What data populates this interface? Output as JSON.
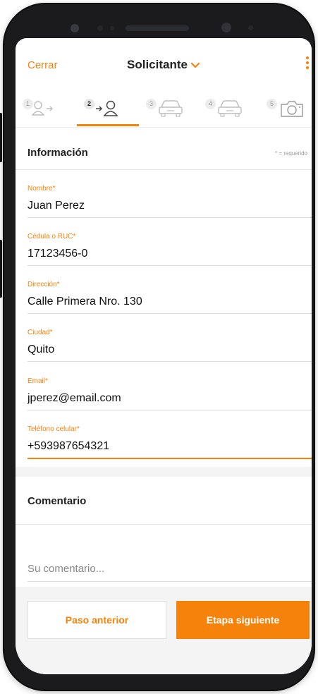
{
  "header": {
    "close_label": "Cerrar",
    "title": "Solicitante",
    "title_chevron": "❯",
    "menu_icon": "kebab-icon"
  },
  "stepper": {
    "active_step": 2,
    "steps": [
      {
        "number": "1",
        "icon": "person-arrow-icon"
      },
      {
        "number": "2",
        "icon": "arrow-person-icon"
      },
      {
        "number": "3",
        "icon": "car-icon"
      },
      {
        "number": "4",
        "icon": "car-icon"
      },
      {
        "number": "5",
        "icon": "camera-icon"
      }
    ]
  },
  "info_section": {
    "title": "Información",
    "required_note": "* = requerido"
  },
  "fields": [
    {
      "label": "Nombre*",
      "value": "Juan Perez"
    },
    {
      "label": "Cédula o RUC*",
      "value": "17123456-0"
    },
    {
      "label": "Dirección*",
      "value": "Calle Primera Nro. 130"
    },
    {
      "label": "Ciudad*",
      "value": "Quito"
    },
    {
      "label": "Email*",
      "value": "jperez@email.com"
    },
    {
      "label": "Teléfono celular*",
      "value": "+593987654321"
    }
  ],
  "comment_section": {
    "title": "Comentario",
    "placeholder": "Su comentario..."
  },
  "footer": {
    "prev_label": "Paso anterior",
    "next_label": "Etapa siguiente"
  },
  "colors": {
    "accent": "#f5820b",
    "text": "#222222",
    "muted": "#999999",
    "band": "#f4f4f4"
  }
}
